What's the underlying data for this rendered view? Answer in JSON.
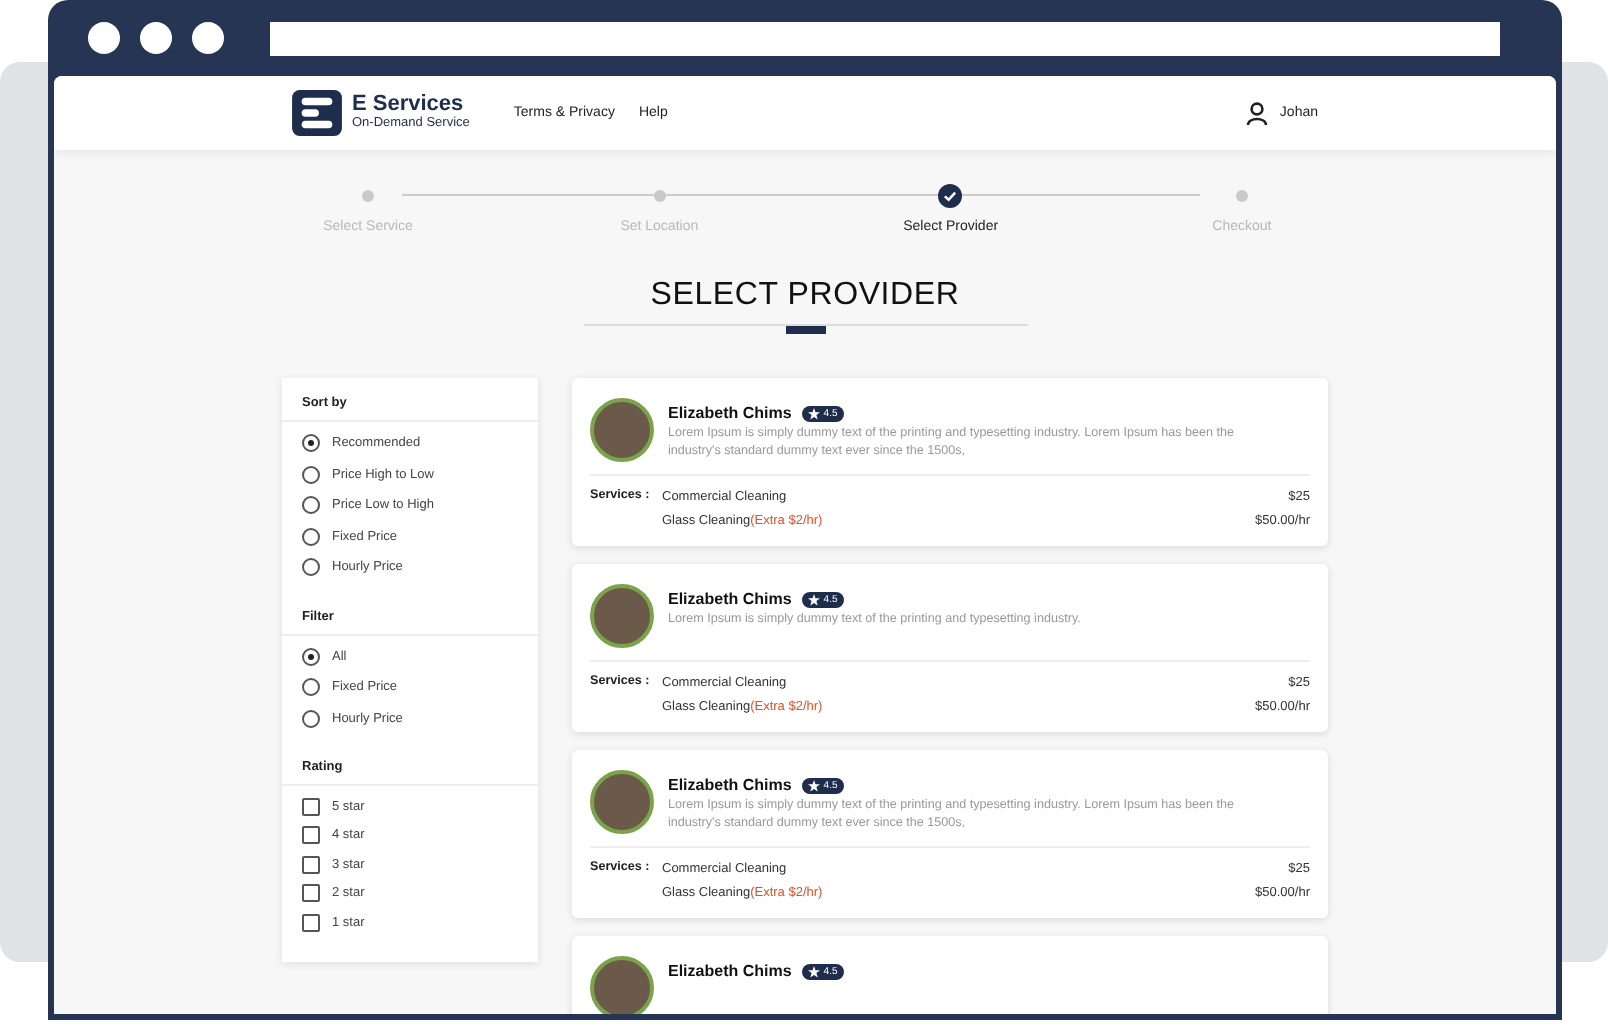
{
  "brand": {
    "name": "E Services",
    "tagline": "On-Demand Service"
  },
  "nav": [
    "Terms & Privacy",
    "Help"
  ],
  "user": {
    "name": "Johan"
  },
  "steps": [
    {
      "label": "Select Service",
      "selected": false
    },
    {
      "label": "Set Location",
      "selected": false
    },
    {
      "label": "Select Provider",
      "selected": true
    },
    {
      "label": "Checkout",
      "selected": false
    }
  ],
  "title": "SELECT PROVIDER",
  "sidebar": {
    "sections": [
      {
        "title": "Sort by",
        "kind": "radio",
        "options": [
          {
            "label": "Recommended",
            "selected": true
          },
          {
            "label": "Price High to Low",
            "selected": false
          },
          {
            "label": "Price Low to High",
            "selected": false
          },
          {
            "label": "Fixed Price",
            "selected": false
          },
          {
            "label": "Hourly Price",
            "selected": false
          }
        ]
      },
      {
        "title": "Filter",
        "kind": "radio",
        "options": [
          {
            "label": "All",
            "selected": true
          },
          {
            "label": "Fixed Price",
            "selected": false
          },
          {
            "label": "Hourly Price",
            "selected": false
          }
        ]
      },
      {
        "title": "Rating",
        "kind": "checkbox",
        "options": [
          {
            "label": "5 star",
            "checked": false
          },
          {
            "label": "4 star",
            "checked": false
          },
          {
            "label": "3 star",
            "checked": false
          },
          {
            "label": "2 star",
            "checked": false
          },
          {
            "label": "1 star",
            "checked": false
          }
        ]
      }
    ]
  },
  "providers": [
    {
      "name": "Elizabeth Chims",
      "rating": "4.5",
      "description": "Lorem Ipsum is simply dummy text of the printing and typesetting industry. Lorem Ipsum has been the industry's standard dummy text ever since the 1500s,",
      "services_label": "Services :",
      "services": [
        {
          "name": "Commercial Cleaning",
          "price": "$25"
        },
        {
          "name": "Glass Cleaning",
          "extra": "(Extra $2/hr)",
          "price": "$50.00/hr"
        }
      ]
    },
    {
      "name": "Elizabeth Chims",
      "rating": "4.5",
      "description": "Lorem Ipsum is simply dummy text of the printing and typesetting industry.",
      "services_label": "Services :",
      "services": [
        {
          "name": "Commercial Cleaning",
          "price": "$25"
        },
        {
          "name": "Glass Cleaning",
          "extra": "(Extra $2/hr)",
          "price": "$50.00/hr"
        }
      ]
    },
    {
      "name": "Elizabeth Chims",
      "rating": "4.5",
      "description": "Lorem Ipsum is simply dummy text of the printing and typesetting industry. Lorem Ipsum has been the industry's standard dummy text ever since the 1500s,",
      "services_label": "Services :",
      "services": [
        {
          "name": "Commercial Cleaning",
          "price": "$25"
        },
        {
          "name": "Glass Cleaning",
          "extra": "(Extra $2/hr)",
          "price": "$50.00/hr"
        }
      ]
    },
    {
      "name": "Elizabeth Chims",
      "rating": "4.5"
    }
  ]
}
